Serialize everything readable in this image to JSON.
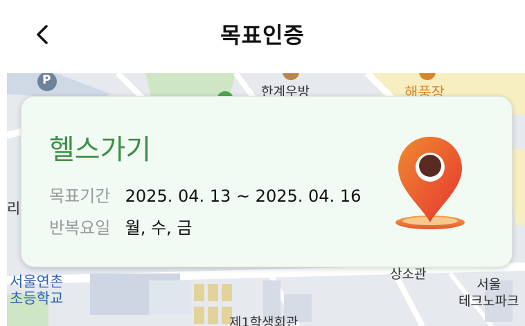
{
  "header": {
    "title": "목표인증",
    "back_icon": "chevron-left-icon"
  },
  "map": {
    "labels": {
      "restaurant1": "한계우방",
      "restaurant2": "해풍장",
      "school": "서울연촌\n초등학교",
      "hall": "상소관",
      "techno": "서울\n테크노파크",
      "student_hall": "제1학생회관",
      "left_cut": "리",
      "parking": "P"
    }
  },
  "card": {
    "goal_name": "헬스가기",
    "period_label": "목표기간",
    "period_value": "2025. 04. 13 ~ 2025. 04. 16",
    "repeat_label": "반복요일",
    "repeat_value": "월, 수, 금",
    "pin_icon": "location-pin-icon"
  },
  "colors": {
    "goal_green": "#3f8d46",
    "card_bg": "#f1fbf3",
    "pin_red": "#e8423a",
    "pin_orange": "#f08a30"
  }
}
